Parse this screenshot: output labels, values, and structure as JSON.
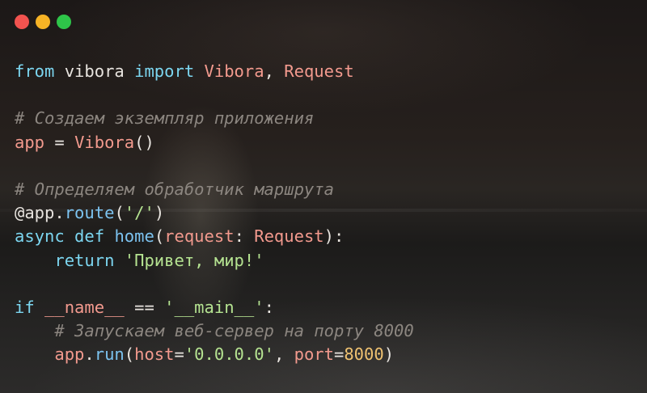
{
  "colors": {
    "close_dot": "#f2534f",
    "minimize_dot": "#f6b325",
    "maximize_dot": "#2ec549",
    "default": "#e8e4df",
    "keyword": "#7cd6f0",
    "type": "#f39a8e",
    "string": "#b5e391",
    "comment": "#8c8680",
    "number": "#efc271",
    "decorator": "#e8e4df",
    "func": "#7cc3f0"
  },
  "window_controls": {
    "close_icon": "close-dot-icon",
    "minimize_icon": "minimize-dot-icon",
    "maximize_icon": "maximize-dot-icon"
  },
  "code_lines": [
    [
      {
        "t": "from",
        "c": "keyword"
      },
      {
        "t": " vibora ",
        "c": "default"
      },
      {
        "t": "import",
        "c": "keyword"
      },
      {
        "t": " ",
        "c": "default"
      },
      {
        "t": "Vibora",
        "c": "type"
      },
      {
        "t": ", ",
        "c": "default"
      },
      {
        "t": "Request",
        "c": "type"
      }
    ],
    [],
    [
      {
        "t": "# Создаем экземпляр приложения",
        "c": "comment",
        "italic": true
      }
    ],
    [
      {
        "t": "app",
        "c": "type"
      },
      {
        "t": " = ",
        "c": "default"
      },
      {
        "t": "Vibora",
        "c": "type"
      },
      {
        "t": "()",
        "c": "default"
      }
    ],
    [],
    [
      {
        "t": "# Определяем обработчик маршрута",
        "c": "comment",
        "italic": true
      }
    ],
    [
      {
        "t": "@app.",
        "c": "decorator"
      },
      {
        "t": "route",
        "c": "func"
      },
      {
        "t": "(",
        "c": "default"
      },
      {
        "t": "'/'",
        "c": "string"
      },
      {
        "t": ")",
        "c": "default"
      }
    ],
    [
      {
        "t": "async def",
        "c": "keyword"
      },
      {
        "t": " ",
        "c": "default"
      },
      {
        "t": "home",
        "c": "func"
      },
      {
        "t": "(",
        "c": "default"
      },
      {
        "t": "request",
        "c": "type"
      },
      {
        "t": ": ",
        "c": "default"
      },
      {
        "t": "Request",
        "c": "type"
      },
      {
        "t": "):",
        "c": "default"
      }
    ],
    [
      {
        "t": "    ",
        "c": "default"
      },
      {
        "t": "return",
        "c": "keyword"
      },
      {
        "t": " ",
        "c": "default"
      },
      {
        "t": "'Привет, мир!'",
        "c": "string"
      }
    ],
    [],
    [
      {
        "t": "if",
        "c": "keyword"
      },
      {
        "t": " ",
        "c": "default"
      },
      {
        "t": "__name__",
        "c": "type"
      },
      {
        "t": " == ",
        "c": "default"
      },
      {
        "t": "'__main__'",
        "c": "string"
      },
      {
        "t": ":",
        "c": "default"
      }
    ],
    [
      {
        "t": "    ",
        "c": "default"
      },
      {
        "t": "# Запускаем веб-сервер на порту 8000",
        "c": "comment",
        "italic": true
      }
    ],
    [
      {
        "t": "    ",
        "c": "default"
      },
      {
        "t": "app",
        "c": "type"
      },
      {
        "t": ".",
        "c": "default"
      },
      {
        "t": "run",
        "c": "func"
      },
      {
        "t": "(",
        "c": "default"
      },
      {
        "t": "host",
        "c": "type"
      },
      {
        "t": "=",
        "c": "default"
      },
      {
        "t": "'0.0.0.0'",
        "c": "string"
      },
      {
        "t": ", ",
        "c": "default"
      },
      {
        "t": "port",
        "c": "type"
      },
      {
        "t": "=",
        "c": "default"
      },
      {
        "t": "8000",
        "c": "number"
      },
      {
        "t": ")",
        "c": "default"
      }
    ]
  ]
}
